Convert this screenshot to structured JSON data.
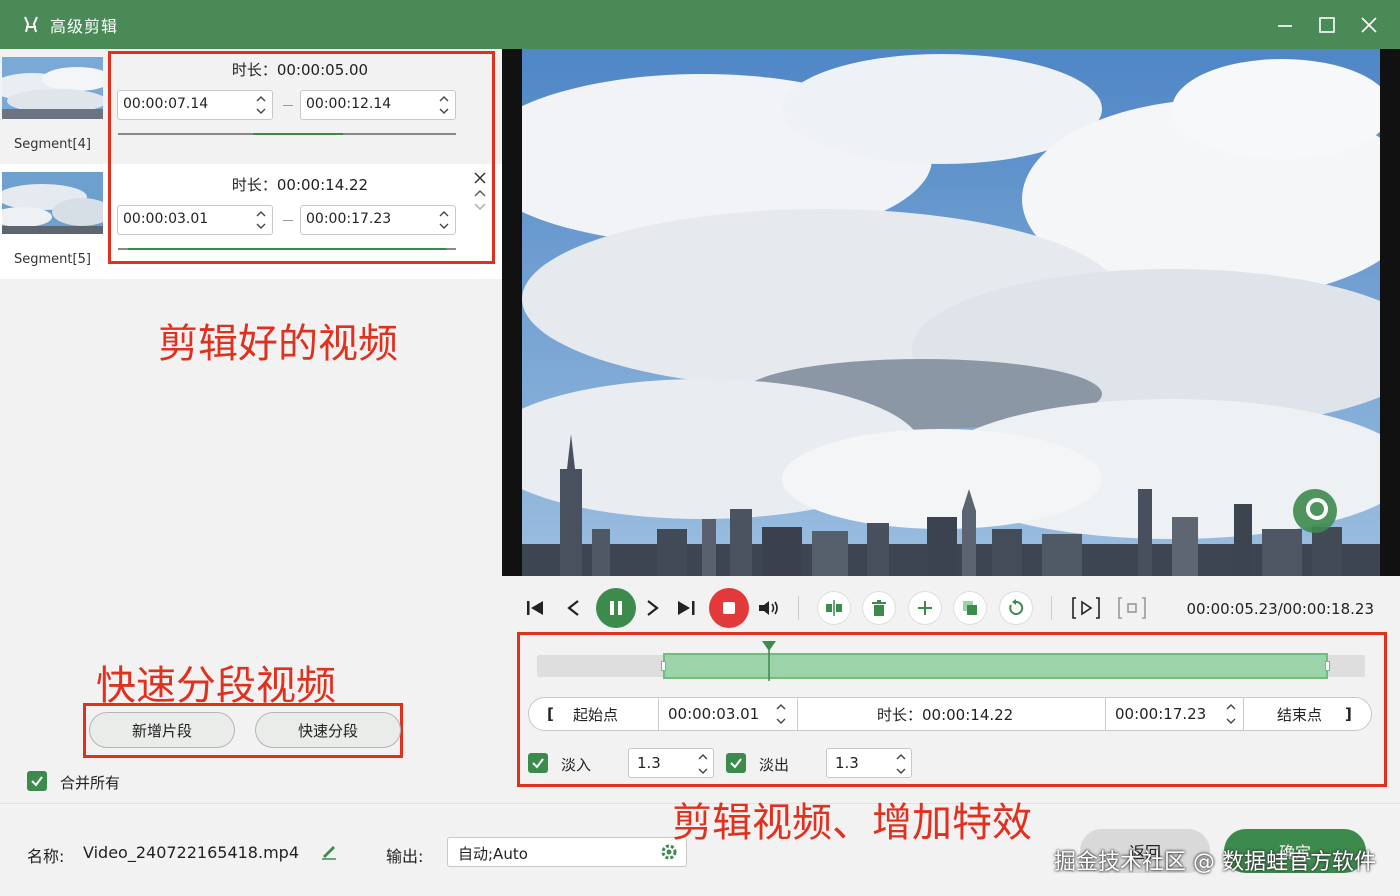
{
  "window": {
    "title": "高级剪辑",
    "controls": [
      "minimize",
      "maximize",
      "close"
    ]
  },
  "segments": [
    {
      "label": "Segment[4]",
      "duration_text": "时长：00:00:05.00",
      "start": "00:00:07.14",
      "end": "00:00:12.14",
      "progress": 0.66
    },
    {
      "label": "Segment[5]",
      "duration_text": "时长：00:00:14.22",
      "start": "00:00:03.01",
      "end": "00:00:17.23",
      "progress": 0.95
    }
  ],
  "annotations": {
    "segments_note": "剪辑好的视频",
    "split_note": "快速分段视频",
    "edit_note": "剪辑视频、增加特效"
  },
  "left_buttons": {
    "add_segment": "新增片段",
    "quick_split": "快速分段"
  },
  "merge_all": {
    "label": "合并所有",
    "checked": true
  },
  "player": {
    "time_readout": "00:00:05.23/00:00:18.23",
    "playhead_fraction": 0.16,
    "icons": [
      "skip-start-icon",
      "step-back-icon",
      "pause-icon",
      "step-forward-icon",
      "skip-end-icon",
      "stop-icon",
      "volume-icon",
      "split-icon",
      "delete-icon",
      "add-icon",
      "copy-icon",
      "reset-icon",
      "preview-icon",
      "crop-icon"
    ]
  },
  "trim": {
    "start_label": "起始点",
    "start_value": "00:00:03.01",
    "duration_text": "时长：00:00:14.22",
    "end_value": "00:00:17.23",
    "end_label": "结束点",
    "bracket_left": "[",
    "bracket_right": "]"
  },
  "effects": {
    "fade_in_label": "淡入",
    "fade_in_value": "1.3",
    "fade_in_checked": true,
    "fade_out_label": "淡出",
    "fade_out_value": "1.3",
    "fade_out_checked": true
  },
  "bottom": {
    "name_label": "名称:",
    "file_name": "Video_240722165418.mp4",
    "output_label": "输出:",
    "output_value": "自动;Auto",
    "cancel_label": "返回",
    "ok_label": "确定",
    "watermark": "掘金技术社区 @ 数据蛙官方软件"
  },
  "colors": {
    "title_bar": "#4a8a57",
    "accent_green": "#3d8a4d",
    "annotation_red": "#e0301e",
    "timeline_selection": "#9dd3a8"
  }
}
